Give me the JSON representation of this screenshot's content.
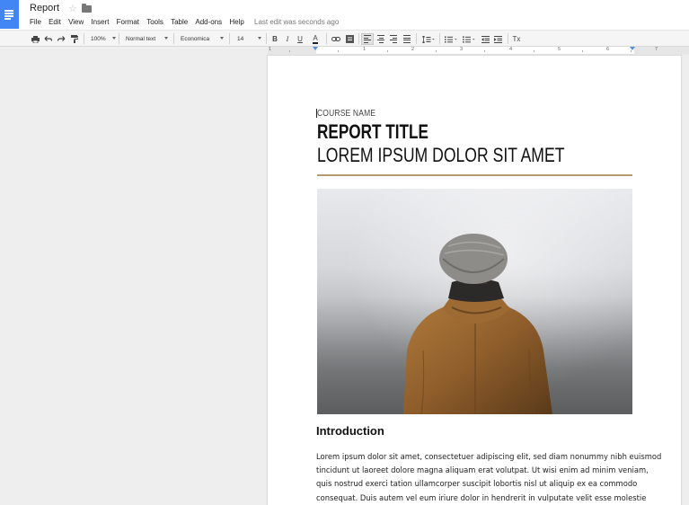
{
  "header": {
    "doc_title": "Report",
    "menu": [
      "File",
      "Edit",
      "View",
      "Insert",
      "Format",
      "Tools",
      "Table",
      "Add-ons",
      "Help"
    ],
    "last_edit": "Last edit was seconds ago",
    "accent_color": "#4285f4"
  },
  "toolbar": {
    "zoom": "100%",
    "style": "Normal text",
    "font": "Economica",
    "font_size": "14",
    "bold": "B",
    "italic": "I",
    "underline": "U",
    "text_color": "A",
    "clear_formatting": "Tx",
    "icons": [
      "print-icon",
      "undo-icon",
      "redo-icon",
      "paint-format-icon",
      "link-icon",
      "comment-icon",
      "align-left-icon",
      "align-center-icon",
      "align-right-icon",
      "justify-icon",
      "line-spacing-icon",
      "numbered-list-icon",
      "bulleted-list-icon",
      "decrease-indent-icon",
      "increase-indent-icon",
      "clear-formatting-icon"
    ]
  },
  "ruler": {
    "numbers": [
      "1",
      "1",
      "2",
      "3",
      "4",
      "5",
      "6",
      "7"
    ]
  },
  "document": {
    "course_name": "COURSE NAME",
    "report_title": "REPORT TITLE",
    "subtitle": "LOREM IPSUM DOLOR SIT AMET",
    "rule_color": "#b59b6d",
    "image_alt": "person in knit hat and brown hooded jacket facing foggy landscape",
    "intro_heading": "Introduction",
    "body_lines": [
      "Lorem ipsum dolor sit amet, consectetuer adipiscing elit, sed diam nonummy nibh euismod",
      "tincidunt ut laoreet dolore magna aliquam erat volutpat. Ut wisi enim ad minim veniam,",
      "quis nostrud exerci tation ullamcorper suscipit lobortis nisl ut aliquip ex ea commodo",
      "consequat. Duis autem vel eum iriure dolor in hendrerit in vulputate velit esse molestie"
    ]
  }
}
